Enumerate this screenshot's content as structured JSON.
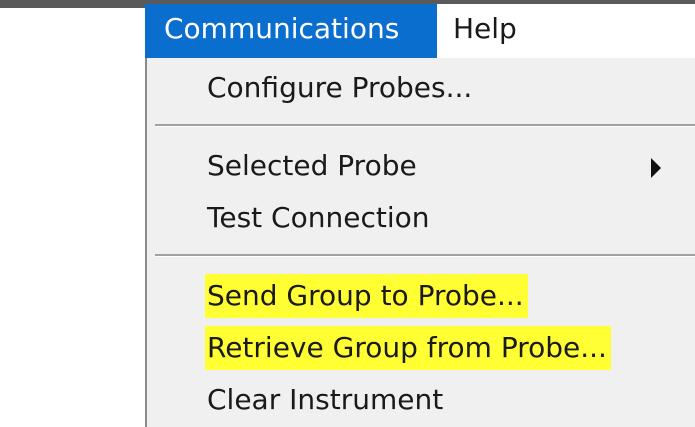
{
  "menubar": {
    "items": [
      {
        "label": "Communications",
        "active": true
      },
      {
        "label": "Help",
        "active": false
      }
    ]
  },
  "dropdown": {
    "items": [
      {
        "label": "Configure Probes...",
        "highlighted": false
      },
      {
        "label": "Selected Probe",
        "has_submenu": true,
        "submenu_icon": "chevron-right-icon",
        "highlighted": false
      },
      {
        "label": "Test Connection",
        "highlighted": false
      },
      {
        "label": "Send Group to Probe...",
        "highlighted": true
      },
      {
        "label": "Retrieve Group from Probe...",
        "highlighted": true
      },
      {
        "label": "Clear Instrument",
        "highlighted": false
      }
    ]
  },
  "colors": {
    "active_menu_bg": "#0a6ecf",
    "active_menu_text": "#ffffff",
    "dropdown_bg": "#f0f0f0",
    "highlight": "#ffff33"
  }
}
